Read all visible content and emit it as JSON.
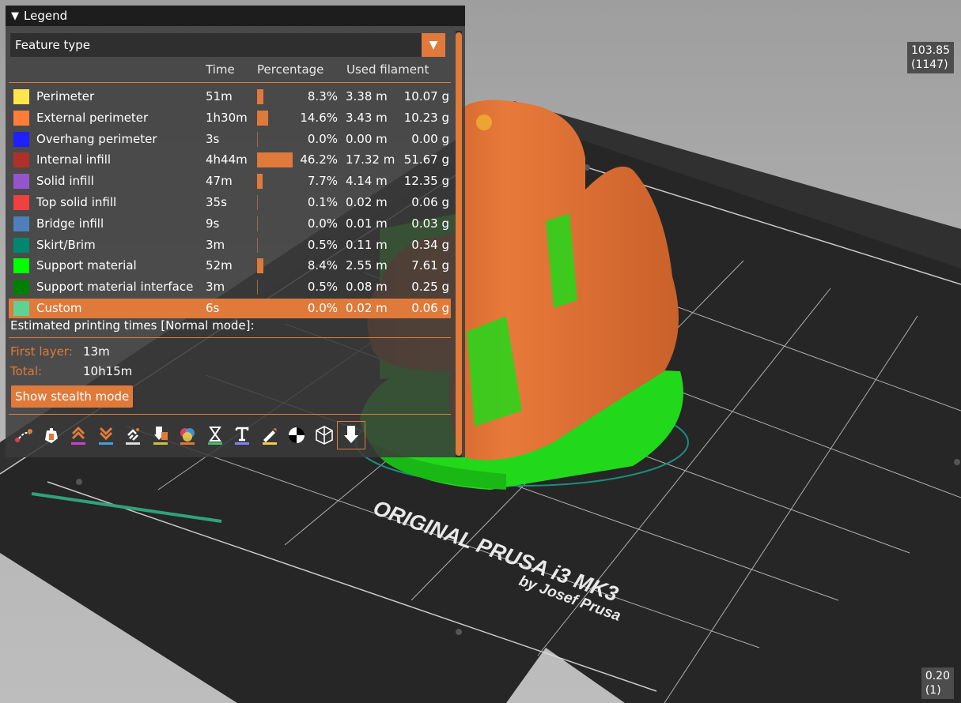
{
  "legend": {
    "title": "Legend",
    "view_type": "Feature type",
    "columns": {
      "time": "Time",
      "percentage": "Percentage",
      "filament": "Used filament"
    },
    "rows": [
      {
        "name": "Perimeter",
        "time": "51m",
        "pct": "8.3%",
        "length": "3.38 m",
        "weight": "10.07 g",
        "color": "#ffe64d",
        "fraction": 0.083
      },
      {
        "name": "External perimeter",
        "time": "1h30m",
        "pct": "14.6%",
        "length": "3.43 m",
        "weight": "10.23 g",
        "color": "#ff7d38",
        "fraction": 0.146
      },
      {
        "name": "Overhang perimeter",
        "time": "3s",
        "pct": "0.0%",
        "length": "0.00 m",
        "weight": "0.00 g",
        "color": "#1f1fff",
        "fraction": 0.0
      },
      {
        "name": "Internal infill",
        "time": "4h44m",
        "pct": "46.2%",
        "length": "17.32 m",
        "weight": "51.67 g",
        "color": "#b03029",
        "fraction": 0.462
      },
      {
        "name": "Solid infill",
        "time": "47m",
        "pct": "7.7%",
        "length": "4.14 m",
        "weight": "12.35 g",
        "color": "#9654cc",
        "fraction": 0.077
      },
      {
        "name": "Top solid infill",
        "time": "35s",
        "pct": "0.1%",
        "length": "0.02 m",
        "weight": "0.06 g",
        "color": "#f04040",
        "fraction": 0.001
      },
      {
        "name": "Bridge infill",
        "time": "9s",
        "pct": "0.0%",
        "length": "0.01 m",
        "weight": "0.03 g",
        "color": "#4d80ba",
        "fraction": 0.0
      },
      {
        "name": "Skirt/Brim",
        "time": "3m",
        "pct": "0.5%",
        "length": "0.11 m",
        "weight": "0.34 g",
        "color": "#00876e",
        "fraction": 0.005
      },
      {
        "name": "Support material",
        "time": "52m",
        "pct": "8.4%",
        "length": "2.55 m",
        "weight": "7.61 g",
        "color": "#00ff00",
        "fraction": 0.084
      },
      {
        "name": "Support material interface",
        "time": "3m",
        "pct": "0.5%",
        "length": "0.08 m",
        "weight": "0.25 g",
        "color": "#008000",
        "fraction": 0.005
      },
      {
        "name": "Custom",
        "time": "6s",
        "pct": "0.0%",
        "length": "0.02 m",
        "weight": "0.06 g",
        "color": "#5ed194",
        "fraction": 0.0,
        "selected": true
      }
    ],
    "estimates": {
      "title": "Estimated printing times [Normal mode]:",
      "first_layer_label": "First layer:",
      "first_layer_value": "13m",
      "total_label": "Total:",
      "total_value": "10h15m"
    },
    "stealth_button": "Show stealth mode",
    "toolbar_icons": [
      "travel-icon",
      "wipe-icon",
      "retractions-icon",
      "deretractions-icon",
      "seams-icon",
      "tool-changes-icon",
      "color-changes-icon",
      "pause-prints-icon",
      "custom-gcodes-icon",
      "center-of-gravity-icon",
      "shells-icon",
      "tool-marker-icon"
    ]
  },
  "slider": {
    "top_value": "103.85",
    "top_layer": "(1147)",
    "bottom_value": "0.20",
    "bottom_layer": "(1)"
  },
  "bed": {
    "brand_line1": "ORIGINAL PRUSA i3 MK3",
    "brand_line2": "by Josef Prusa"
  },
  "colors": {
    "accent": "#e07a3a",
    "panel": "#3a3a3a",
    "model_orange": "#e06f2c",
    "support_green": "#22e01a"
  }
}
